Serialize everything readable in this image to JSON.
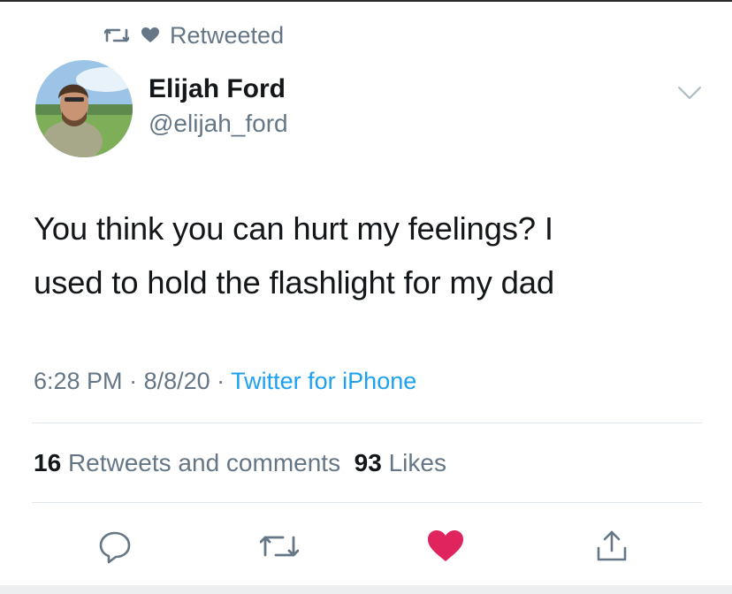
{
  "context": {
    "label": "Retweeted",
    "retweet_icon": "retweet-icon",
    "heart_icon": "heart-icon"
  },
  "author": {
    "name": "Elijah Ford",
    "handle": "@elijah_ford"
  },
  "tweet": {
    "text_line1": "You think you can hurt my feelings? I",
    "text_line2": "used to hold the flashlight for my dad"
  },
  "meta": {
    "time": "6:28 PM",
    "sep1": " · ",
    "date": "8/8/20",
    "sep2": " · ",
    "source": "Twitter for iPhone"
  },
  "stats": {
    "retweets_count": "16",
    "retweets_label": "Retweets and comments",
    "likes_count": "93",
    "likes_label": "Likes"
  },
  "actions": [
    "reply-icon",
    "retweet-icon",
    "like-icon",
    "share-icon"
  ],
  "colors": {
    "link": "#1da1f2",
    "secondary": "#657786",
    "like": "#e0245e",
    "text": "#14171a",
    "divider": "#e1e8ed"
  }
}
